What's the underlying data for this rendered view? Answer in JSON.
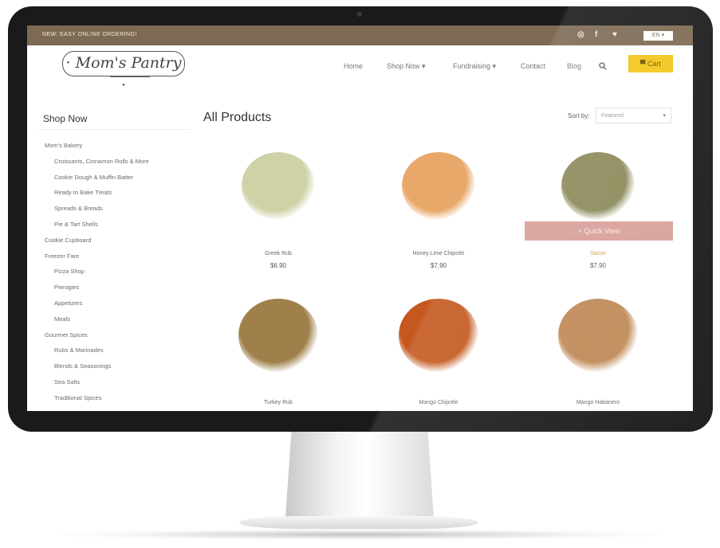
{
  "topbar": {
    "promo": "NEW: EASY ONLINE ORDERING!",
    "social_icons": [
      "instagram-icon",
      "facebook-icon",
      "twitter-icon"
    ],
    "language": "EN"
  },
  "header": {
    "logo_text": "Mom's Pantry",
    "nav": [
      "Home",
      "Shop Now",
      "Fundraising",
      "Contact",
      "Blog"
    ],
    "search_icon": "search-icon",
    "cart_label": "Cart",
    "cart_icon": "cart-icon"
  },
  "sidebar": {
    "title": "Shop Now",
    "items": [
      {
        "label": "Mom's Bakery",
        "level": 0
      },
      {
        "label": "Croissants, Cinnamon Rolls & More",
        "level": 1
      },
      {
        "label": "Cookie Dough & Muffin Batter",
        "level": 1
      },
      {
        "label": "Ready to Bake Treats",
        "level": 1
      },
      {
        "label": "Spreads & Breads",
        "level": 1
      },
      {
        "label": "Pie & Tart Shells",
        "level": 1
      },
      {
        "label": "Cookie Cupboard",
        "level": 0
      },
      {
        "label": "Freezer Fare",
        "level": 0
      },
      {
        "label": "Pizza Shop",
        "level": 1
      },
      {
        "label": "Pierogies",
        "level": 1
      },
      {
        "label": "Appetizers",
        "level": 1
      },
      {
        "label": "Meals",
        "level": 1
      },
      {
        "label": "Gourmet Spices",
        "level": 0
      },
      {
        "label": "Rubs & Marinades",
        "level": 1
      },
      {
        "label": "Blends & Seasonings",
        "level": 1
      },
      {
        "label": "Sea Salts",
        "level": 1
      },
      {
        "label": "Traditional Spices",
        "level": 1
      }
    ]
  },
  "main": {
    "title": "All Products",
    "sort_label": "Sort by:",
    "sort_value": "Featured",
    "quick_view": "+ Quick View",
    "products": [
      {
        "name": "Greek Rub",
        "price": "$6.90",
        "color": "#cfd2a6"
      },
      {
        "name": "Honey Lime Chipotle",
        "price": "$7.90",
        "color": "#e8a86a"
      },
      {
        "name": "Sazon",
        "price": "$7.90",
        "color": "#8c8a5a"
      },
      {
        "name": "Turkey Rub",
        "price": "",
        "color": "#a0804a"
      },
      {
        "name": "Mango Chipotle",
        "price": "",
        "color": "#c4581e"
      },
      {
        "name": "Mango Habanero",
        "price": "",
        "color": "#bf8a58"
      }
    ]
  },
  "colors": {
    "topbar": "#7d6a53",
    "cart": "#f3c51a",
    "quick_view": "#d9a09a",
    "bezel": "#1a1a1c"
  }
}
